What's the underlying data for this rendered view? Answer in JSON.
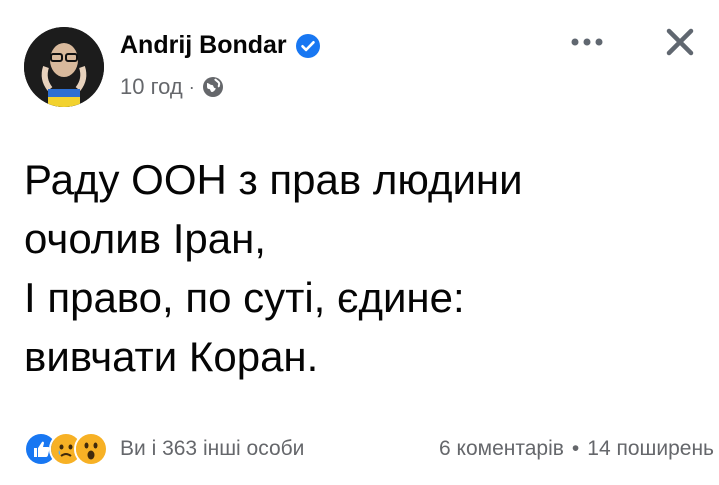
{
  "post": {
    "author": "Andrij Bondar",
    "time": "10 год",
    "separator": "·",
    "text": "Раду ООН з прав людини\nочолив Іран,\nІ право, по суті, єдине:\nвивчати Коран."
  },
  "footer": {
    "reactions_text": "Ви і 363 інші особи",
    "comments": "6 коментарів",
    "dot": "•",
    "shares": "14 поширень"
  },
  "icons": {
    "verified": "verified-badge-icon",
    "privacy": "globe-icon",
    "more": "more-icon",
    "close": "close-icon",
    "reactions": [
      "like-icon",
      "sad-icon",
      "wow-icon"
    ]
  },
  "colors": {
    "verified": "#1877f2",
    "like": "#1877f2",
    "reaction_yellow": "#f7b125",
    "secondary_text": "#65676b"
  }
}
